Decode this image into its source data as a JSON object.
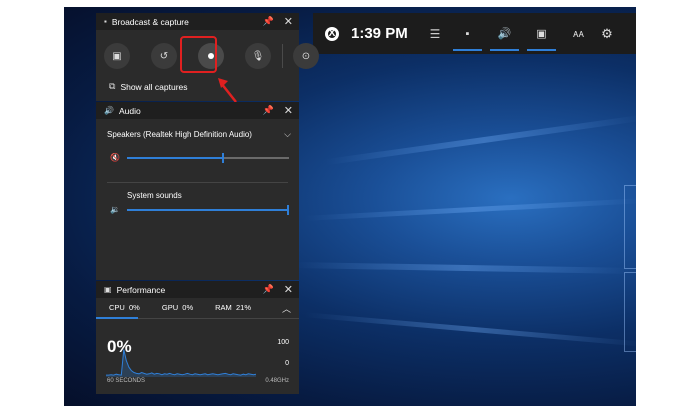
{
  "gamebar": {
    "time": "1:39 PM",
    "menu_icon": "menu-icon",
    "widgets": [
      {
        "icon": "broadcast-widget-icon",
        "glyph": "▪",
        "active": true
      },
      {
        "icon": "audio-widget-icon",
        "glyph": "🔊",
        "active": true
      },
      {
        "icon": "performance-widget-icon",
        "glyph": "▣",
        "active": true
      },
      {
        "icon": "social-widget-icon",
        "glyph": "ᴀᴀ",
        "active": false
      }
    ],
    "settings_icon": "gear-icon"
  },
  "broadcast": {
    "title": "Broadcast & capture",
    "buttons": [
      {
        "name": "screenshot-button",
        "icon": "camera-icon",
        "glyph": "▣"
      },
      {
        "name": "record-last-button",
        "icon": "replay-icon",
        "glyph": "↺"
      },
      {
        "name": "record-button",
        "icon": "record-dot-icon",
        "glyph": ""
      },
      {
        "name": "microphone-button",
        "icon": "mic-off-icon",
        "glyph": "🎙"
      },
      {
        "name": "broadcast-button",
        "icon": "broadcast-icon",
        "glyph": "⊙"
      }
    ],
    "show_all": "Show all captures"
  },
  "audio": {
    "title": "Audio",
    "device": "Speakers (Realtek High Definition Audio)",
    "master_volume": 0.6,
    "system_label": "System sounds",
    "system_volume": 1.0
  },
  "performance": {
    "title": "Performance",
    "tabs": [
      {
        "label": "CPU",
        "value": "0%"
      },
      {
        "label": "GPU",
        "value": "0%"
      },
      {
        "label": "RAM",
        "value": "21%"
      }
    ],
    "current": "0%",
    "max": "100",
    "min": "0",
    "range_label": "60 SECONDS",
    "freq_label": "0.48GHz",
    "series": [
      2,
      2,
      3,
      2,
      4,
      3,
      2,
      60,
      35,
      20,
      12,
      8,
      6,
      5,
      8,
      6,
      4,
      5,
      7,
      4,
      6,
      5,
      3,
      5,
      4,
      6,
      4,
      3,
      5,
      4,
      3,
      4,
      6,
      4,
      3,
      5,
      4,
      3,
      4,
      5,
      3,
      4,
      5,
      4,
      3,
      4,
      5,
      6,
      4,
      3,
      5,
      4,
      3,
      2,
      4,
      3,
      5,
      4,
      3,
      4
    ]
  },
  "colors": {
    "accent": "#2f7fd8",
    "highlight": "#e02020",
    "panel_bg": "#2b2b2b",
    "header_bg": "#1f1f1f"
  }
}
